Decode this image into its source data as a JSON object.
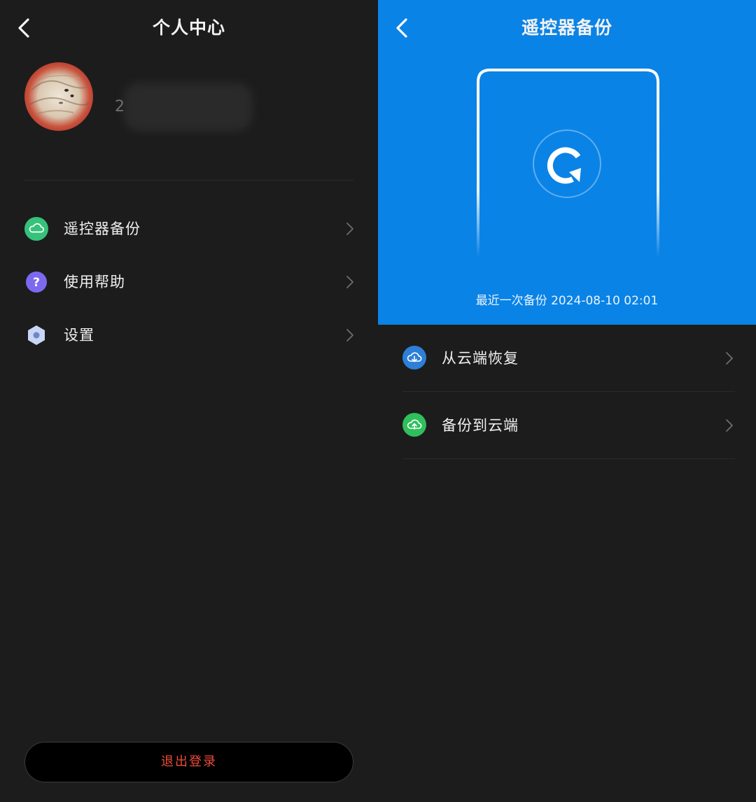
{
  "left": {
    "title": "个人中心",
    "profile": {
      "username_visible_initial": "2"
    },
    "menu": [
      {
        "label": "遥控器备份",
        "icon": "cloud-icon",
        "icon_color": "#35c27a"
      },
      {
        "label": "使用帮助",
        "icon": "question-icon",
        "icon_color": "#7b6af0"
      },
      {
        "label": "设置",
        "icon": "hexagon-settings-icon",
        "icon_color": "#c9d6f5"
      }
    ],
    "logout_label": "退出登录",
    "logout_color": "#f04a3a"
  },
  "right": {
    "title": "遥控器备份",
    "header_color": "#0a83e6",
    "last_backup": "最近一次备份 2024-08-10 02:01",
    "actions": [
      {
        "label": "从云端恢复",
        "icon": "cloud-download-icon",
        "icon_color": "#2d7fd8"
      },
      {
        "label": "备份到云端",
        "icon": "cloud-upload-icon",
        "icon_color": "#2fbf5c"
      }
    ]
  }
}
